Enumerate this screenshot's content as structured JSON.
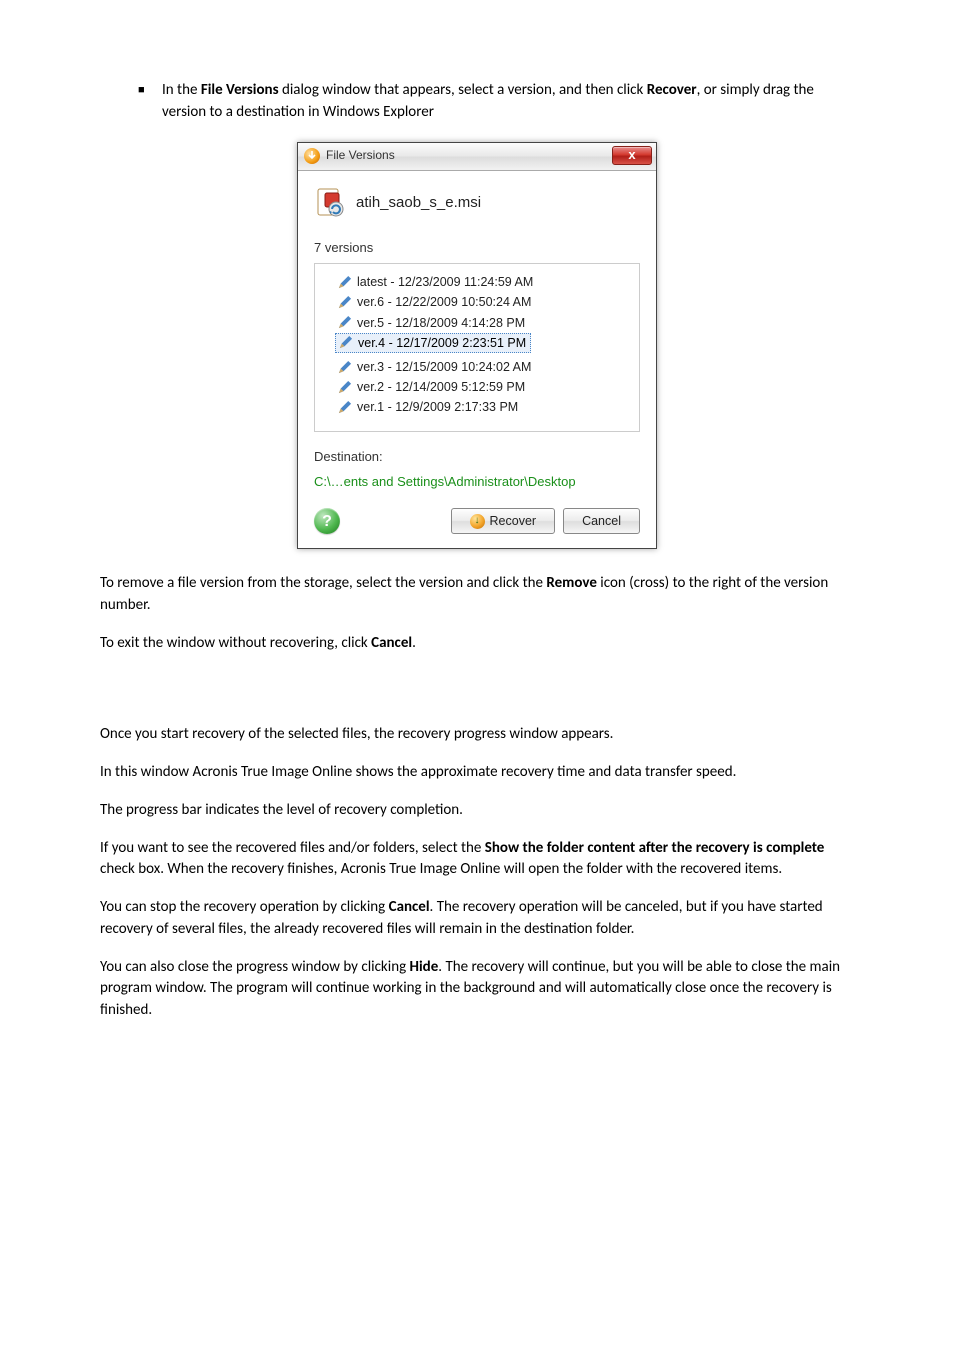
{
  "intro": {
    "prefix": "In the ",
    "bold1": "File Versions",
    "mid": " dialog window that appears, select a version, and then click ",
    "bold2": "Recover",
    "suffix": ", or simply drag the version to a destination in Windows Explorer"
  },
  "dialog": {
    "title": "File Versions",
    "close": "x",
    "filename": "atih_saob_s_e.msi",
    "versions_label": "7 versions",
    "versions": [
      "latest - 12/23/2009 11:24:59 AM",
      "ver.6 - 12/22/2009 10:50:24 AM",
      "ver.5 - 12/18/2009 4:14:28 PM",
      "ver.4 - 12/17/2009 2:23:51 PM",
      "ver.3 - 12/15/2009 10:24:02 AM",
      "ver.2 - 12/14/2009 5:12:59 PM",
      "ver.1 - 12/9/2009 2:17:33 PM"
    ],
    "selected_index": 3,
    "destination_label": "Destination:",
    "destination_path": "C:\\…ents and Settings\\Administrator\\Desktop",
    "help": "?",
    "recover_btn": "Recover",
    "cancel_btn": "Cancel"
  },
  "after1": {
    "prefix": "To remove a file version from the storage, select the version and click the ",
    "bold": "Remove",
    "suffix": " icon (cross) to the right of the version number."
  },
  "after2": {
    "prefix": "To exit the window without recovering, click ",
    "bold": "Cancel",
    "suffix": "."
  },
  "p_once": "Once you start recovery of the selected files, the recovery progress window appears.",
  "p_window": "In this window Acronis True Image Online shows the approximate recovery time and data transfer speed.",
  "p_progress": "The progress bar indicates the level of recovery completion.",
  "p_show": {
    "prefix": "If you want to see the recovered files and/or folders, select the ",
    "bold": "Show the folder content after the recovery is complete",
    "suffix": " check box. When the recovery finishes, Acronis True Image Online will open the folder with the recovered items."
  },
  "p_stop": {
    "prefix": "You can stop the recovery operation by clicking ",
    "bold": "Cancel",
    "suffix": ". The recovery operation will be canceled, but if you have started recovery of several files, the already recovered files will remain in the destination folder."
  },
  "p_hide": {
    "prefix": "You can also close the progress window by clicking ",
    "bold": "Hide",
    "suffix": ". The recovery will continue, but you will be able to close the main program window. The program will continue working in the background and will automatically close once the recovery is finished."
  }
}
